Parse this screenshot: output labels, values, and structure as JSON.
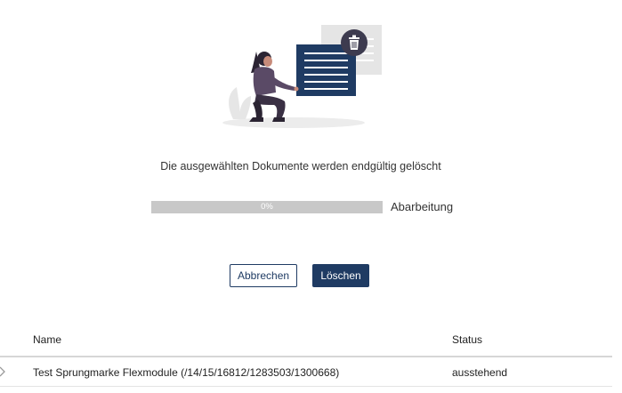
{
  "illustration": {
    "icon": "trash-icon"
  },
  "dialog": {
    "message": "Die ausgewählten Dokumente werden endgültig gelöscht",
    "progress": {
      "value_percent": 0,
      "text": "0%",
      "label": "Abarbeitung"
    },
    "cancel_label": "Abbrechen",
    "delete_label": "Löschen"
  },
  "table": {
    "columns": [
      "Name",
      "Status"
    ],
    "rows": [
      {
        "name": "Test Sprungmarke Flexmodule (/14/15/16812/1283503/1300668)",
        "status": "ausstehend"
      }
    ]
  },
  "colors": {
    "primary": "#1f3b63",
    "progress_track": "#c8c8c8",
    "accent_person": "#4a3f55"
  }
}
